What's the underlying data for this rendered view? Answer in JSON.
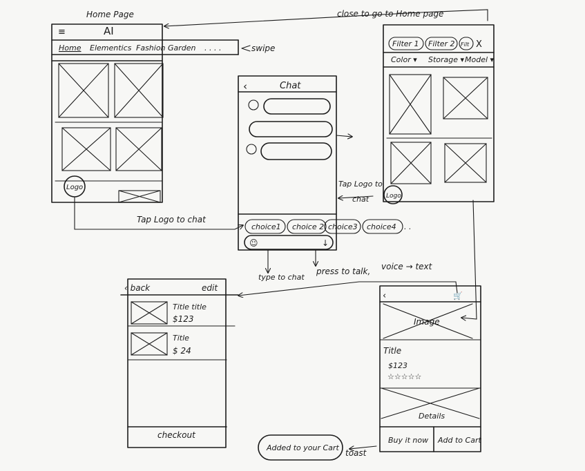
{
  "notes": {
    "home_page": "Home Page",
    "close_to_home": "close to go to Home page",
    "swipe": "swipe",
    "tap_logo_chat_bottom": "Tap Logo to chat",
    "tap_logo_chat_right_1": "Tap Logo to",
    "tap_logo_chat_right_2": "chat",
    "type_to_chat": "type to chat",
    "press_to_talk": "press to talk,",
    "voice_to_text": "voice → text",
    "toast_note": "toast"
  },
  "home": {
    "menu_icon": "≡",
    "title": "AI",
    "tabs": [
      "Home",
      "Elementics",
      "Fashion",
      "Garden",
      ". . . ."
    ],
    "logo": "Logo"
  },
  "chat": {
    "back_icon": "‹",
    "title": "Chat",
    "choices": [
      "choice1",
      "choice 2",
      "choice3",
      "choice4",
      ". ."
    ],
    "smile_icon": "☺",
    "mic_icon": "↓"
  },
  "filter": {
    "filters": [
      "Filter 1",
      "Filter 2",
      "Filt"
    ],
    "close_icon": "X",
    "dropdowns": [
      "Color ▾",
      "Storage ▾",
      "Model ▾"
    ],
    "logo": "Logo"
  },
  "cart": {
    "back": "‹ back",
    "edit": "edit",
    "items": [
      {
        "title": "Title title",
        "price": "$123"
      },
      {
        "title": "Title",
        "price": "$ 24"
      }
    ],
    "checkout": "checkout"
  },
  "product": {
    "back_icon": "‹",
    "cart_icon": "🛒",
    "image_label": "Image",
    "title": "Title",
    "price": "$123",
    "stars": "☆☆☆☆☆",
    "details": "Details",
    "buy_now": "Buy it now",
    "add_to_cart": "Add to Cart"
  },
  "toast": {
    "text": "Added to your Cart"
  }
}
